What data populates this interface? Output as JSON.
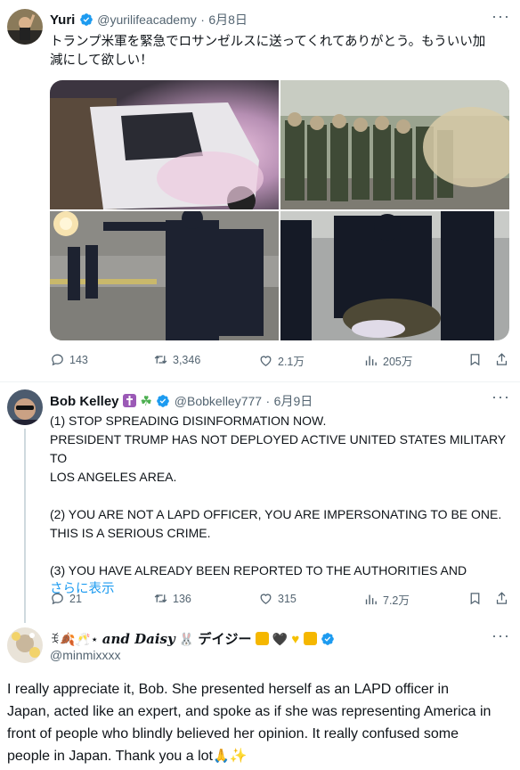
{
  "tweet1": {
    "display_name": "Yuri",
    "handle": "@yurilifeacademy",
    "date": "6月8日",
    "text_line1": "トランプ米軍を緊急でロサンゼルスに送ってくれてありがとう。もういい加",
    "text_line2": "減にして欲しい！",
    "replies": "143",
    "retweets": "3,346",
    "likes": "2.1万",
    "views": "205万"
  },
  "tweet2": {
    "display_name": "Bob Kelley",
    "name_emojis": [
      "latin-cross",
      "shamrock"
    ],
    "handle": "@Bobkelley777",
    "date": "6月9日",
    "lines": [
      "(1) STOP SPREADING DISINFORMATION NOW.",
      "PRESIDENT TRUMP HAS NOT DEPLOYED ACTIVE UNITED STATES MILITARY TO",
      "LOS ANGELES AREA.",
      "(2) YOU ARE NOT A LAPD OFFICER, YOU ARE IMPERSONATING TO BE ONE.",
      "THIS IS A SERIOUS CRIME.",
      "(3) YOU HAVE ALREADY BEEN REPORTED TO THE AUTHORITIES AND"
    ],
    "show_more": "さらに表示",
    "replies": "21",
    "retweets": "136",
    "likes": "315",
    "views": "7.2万"
  },
  "tweet3": {
    "display_name_prefix": "ꉂ🍂🥂⋆",
    "display_name_main": "and Daisy",
    "display_name_suffix": "デイジー",
    "handle": "@minmixxxx",
    "text_lines": [
      "I really appreciate it, Bob. She presented herself as an LAPD officer in",
      "Japan, acted like an expert, and spoke as if she was representing America in",
      "front of people who blindly believed her opinion. It really confused some",
      "people in Japan. Thank you a lot"
    ]
  },
  "colors": {
    "accent": "#1d9bf0",
    "text": "#0f1419",
    "muted": "#536471",
    "line": "#cfd9de"
  },
  "icons": [
    "reply-icon",
    "retweet-icon",
    "like-icon",
    "views-icon",
    "bookmark-icon",
    "share-icon",
    "verified-badge-icon",
    "more-icon"
  ]
}
